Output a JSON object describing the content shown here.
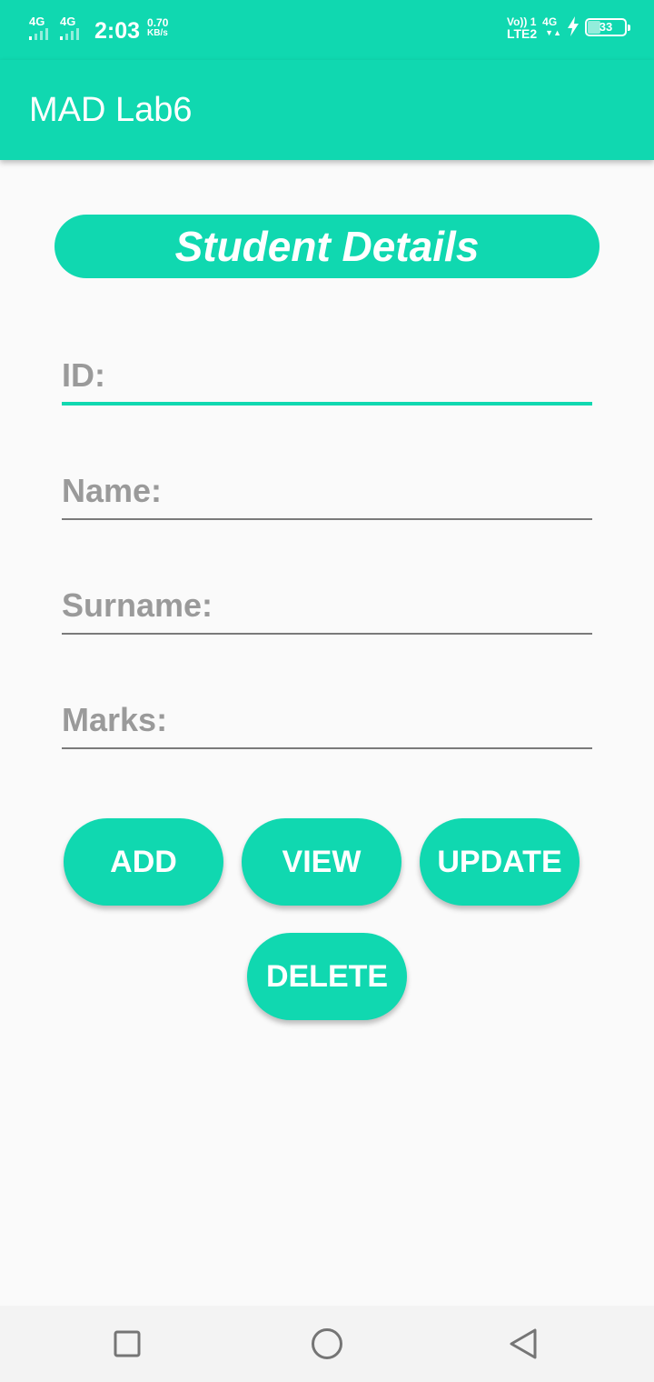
{
  "status_bar": {
    "sim1_type": "4G",
    "sim2_type": "4G",
    "time": "2:03",
    "speed_value": "0.70",
    "speed_unit": "KB/s",
    "volte_top": "Vo)) 1",
    "volte_bottom": "LTE2",
    "data_type": "4G",
    "data_arrows": "▼▲",
    "battery_percent": "33",
    "battery_level": 0.33
  },
  "app_bar": {
    "title": "MAD Lab6"
  },
  "form": {
    "header": "Student Details",
    "fields": [
      {
        "name": "id",
        "placeholder": "ID:",
        "value": ""
      },
      {
        "name": "name",
        "placeholder": "Name:",
        "value": ""
      },
      {
        "name": "surname",
        "placeholder": "Surname:",
        "value": ""
      },
      {
        "name": "marks",
        "placeholder": "Marks:",
        "value": ""
      }
    ]
  },
  "buttons": {
    "add": "ADD",
    "view": "VIEW",
    "update": "UPDATE",
    "delete": "DELETE"
  },
  "colors": {
    "accent": "#10d8b0",
    "background": "#fafafa",
    "hint_text": "#9a9a9a",
    "underline": "#7a7a7a"
  },
  "nav_bar": {
    "icons": [
      "recents-square-icon",
      "home-circle-icon",
      "back-triangle-icon"
    ]
  }
}
